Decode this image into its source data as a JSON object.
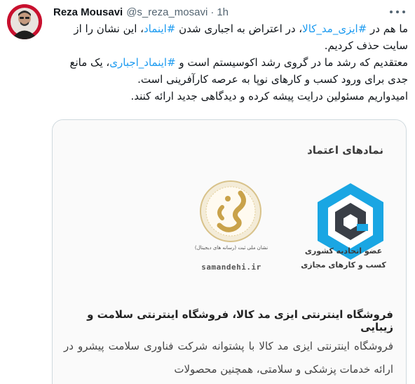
{
  "tweet": {
    "author_name": "Reza Mousavi",
    "handle": "@s_reza_mosavi",
    "separator": "·",
    "time": "1h",
    "paragraphs": [
      {
        "pre": "ما هم در ",
        "tag1": "#ایزی_مد_کالا",
        "mid": "، در اعتراض به اجباری شدن ",
        "tag2": "#اینماد",
        "post": "، این نشان را از سایت حذف کردیم."
      },
      {
        "pre": "معتقدیم که رشد ما در گروی رشد اکوسیستم است و ",
        "tag": "#اینماد_اجباری",
        "post": "، یک مانع جدی برای ورود کسب و کارهای نوپا به عرصه کارآفرینی است."
      },
      {
        "text": "امیدواریم مسئولین درایت پیشه کرده و دیدگاهی جدید ارائه کنند."
      }
    ]
  },
  "card": {
    "trust_title": "نمادهای اعتماد",
    "enamad_line1": "عضو اتحادیه کشوری",
    "enamad_line2": "کسب و کارهای مجازی",
    "samandehi_caption": "نشان ملی ثبت (رسانه های دیجیتال)",
    "samandehi_url": "samandehi.ir",
    "store_title": "فروشگاه اینترنتی ایزی مد کالا، فروشگاه اینترنتی سلامت و زیبایی",
    "store_description": "فروشگاه اینترنتی ایزی مد کالا با پشتوانه شرکت فناوری سلامت پیشرو در ارائه خدمات پزشکی و سلامتی، همچنین محصولات"
  },
  "colors": {
    "link": "#1d9bf0",
    "enamad_blue": "#1aa6e3",
    "enamad_dark": "#3a3f47",
    "samandehi_gold": "#c9a24a",
    "avatar_red": "#c8102e"
  },
  "icons": {
    "more": "more-icon",
    "enamad": "enamad-logo",
    "samandehi": "samandehi-logo"
  }
}
